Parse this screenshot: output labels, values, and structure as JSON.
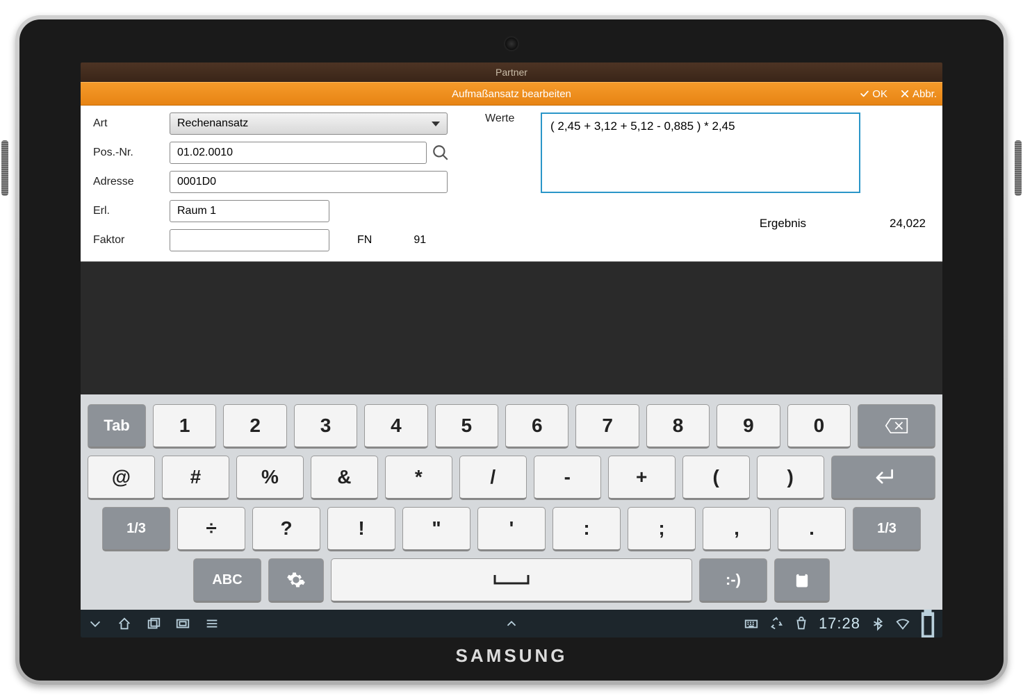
{
  "app": {
    "title": "Partner"
  },
  "dialog": {
    "title": "Aufmaßansatz bearbeiten",
    "ok_label": "OK",
    "cancel_label": "Abbr."
  },
  "form": {
    "art_label": "Art",
    "art_value": "Rechenansatz",
    "pos_label": "Pos.-Nr.",
    "pos_value": "01.02.0010",
    "adresse_label": "Adresse",
    "adresse_value": "0001D0",
    "erl_label": "Erl.",
    "erl_value": "Raum 1",
    "faktor_label": "Faktor",
    "faktor_value": "",
    "fn_label": "FN",
    "fn_value": "91",
    "werte_label": "Werte",
    "werte_value": "( 2,45 + 3,12 + 5,12 - 0,885 ) * 2,45",
    "result_label": "Ergebnis",
    "result_value": "24,022"
  },
  "keyboard": {
    "row1": [
      "Tab",
      "1",
      "2",
      "3",
      "4",
      "5",
      "6",
      "7",
      "8",
      "9",
      "0",
      "⌫"
    ],
    "row2": [
      "@",
      "#",
      "%",
      "&",
      "*",
      "/",
      "-",
      "+",
      "(",
      ")",
      "↵"
    ],
    "row3": [
      "1/3",
      "÷",
      "?",
      "!",
      "\"",
      "'",
      ":",
      ";",
      ",",
      ".",
      "1/3"
    ],
    "row4": [
      "ABC",
      "⚙",
      " ",
      ":-)",
      "📎"
    ]
  },
  "status": {
    "time": "17:28"
  }
}
